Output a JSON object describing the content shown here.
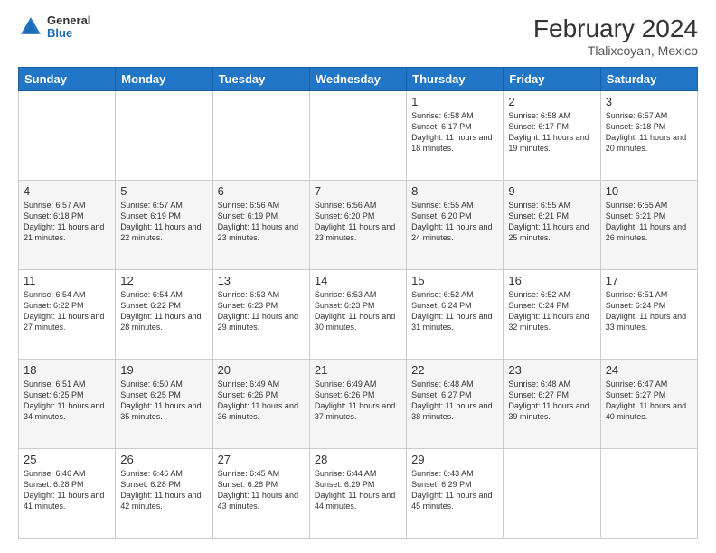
{
  "header": {
    "month_year": "February 2024",
    "location": "Tlalixcoyan, Mexico",
    "logo_general": "General",
    "logo_blue": "Blue"
  },
  "days_of_week": [
    "Sunday",
    "Monday",
    "Tuesday",
    "Wednesday",
    "Thursday",
    "Friday",
    "Saturday"
  ],
  "weeks": [
    [
      {
        "day": "",
        "info": ""
      },
      {
        "day": "",
        "info": ""
      },
      {
        "day": "",
        "info": ""
      },
      {
        "day": "",
        "info": ""
      },
      {
        "day": "1",
        "info": "Sunrise: 6:58 AM\nSunset: 6:17 PM\nDaylight: 11 hours and 18 minutes."
      },
      {
        "day": "2",
        "info": "Sunrise: 6:58 AM\nSunset: 6:17 PM\nDaylight: 11 hours and 19 minutes."
      },
      {
        "day": "3",
        "info": "Sunrise: 6:57 AM\nSunset: 6:18 PM\nDaylight: 11 hours and 20 minutes."
      }
    ],
    [
      {
        "day": "4",
        "info": "Sunrise: 6:57 AM\nSunset: 6:18 PM\nDaylight: 11 hours and 21 minutes."
      },
      {
        "day": "5",
        "info": "Sunrise: 6:57 AM\nSunset: 6:19 PM\nDaylight: 11 hours and 22 minutes."
      },
      {
        "day": "6",
        "info": "Sunrise: 6:56 AM\nSunset: 6:19 PM\nDaylight: 11 hours and 23 minutes."
      },
      {
        "day": "7",
        "info": "Sunrise: 6:56 AM\nSunset: 6:20 PM\nDaylight: 11 hours and 23 minutes."
      },
      {
        "day": "8",
        "info": "Sunrise: 6:55 AM\nSunset: 6:20 PM\nDaylight: 11 hours and 24 minutes."
      },
      {
        "day": "9",
        "info": "Sunrise: 6:55 AM\nSunset: 6:21 PM\nDaylight: 11 hours and 25 minutes."
      },
      {
        "day": "10",
        "info": "Sunrise: 6:55 AM\nSunset: 6:21 PM\nDaylight: 11 hours and 26 minutes."
      }
    ],
    [
      {
        "day": "11",
        "info": "Sunrise: 6:54 AM\nSunset: 6:22 PM\nDaylight: 11 hours and 27 minutes."
      },
      {
        "day": "12",
        "info": "Sunrise: 6:54 AM\nSunset: 6:22 PM\nDaylight: 11 hours and 28 minutes."
      },
      {
        "day": "13",
        "info": "Sunrise: 6:53 AM\nSunset: 6:23 PM\nDaylight: 11 hours and 29 minutes."
      },
      {
        "day": "14",
        "info": "Sunrise: 6:53 AM\nSunset: 6:23 PM\nDaylight: 11 hours and 30 minutes."
      },
      {
        "day": "15",
        "info": "Sunrise: 6:52 AM\nSunset: 6:24 PM\nDaylight: 11 hours and 31 minutes."
      },
      {
        "day": "16",
        "info": "Sunrise: 6:52 AM\nSunset: 6:24 PM\nDaylight: 11 hours and 32 minutes."
      },
      {
        "day": "17",
        "info": "Sunrise: 6:51 AM\nSunset: 6:24 PM\nDaylight: 11 hours and 33 minutes."
      }
    ],
    [
      {
        "day": "18",
        "info": "Sunrise: 6:51 AM\nSunset: 6:25 PM\nDaylight: 11 hours and 34 minutes."
      },
      {
        "day": "19",
        "info": "Sunrise: 6:50 AM\nSunset: 6:25 PM\nDaylight: 11 hours and 35 minutes."
      },
      {
        "day": "20",
        "info": "Sunrise: 6:49 AM\nSunset: 6:26 PM\nDaylight: 11 hours and 36 minutes."
      },
      {
        "day": "21",
        "info": "Sunrise: 6:49 AM\nSunset: 6:26 PM\nDaylight: 11 hours and 37 minutes."
      },
      {
        "day": "22",
        "info": "Sunrise: 6:48 AM\nSunset: 6:27 PM\nDaylight: 11 hours and 38 minutes."
      },
      {
        "day": "23",
        "info": "Sunrise: 6:48 AM\nSunset: 6:27 PM\nDaylight: 11 hours and 39 minutes."
      },
      {
        "day": "24",
        "info": "Sunrise: 6:47 AM\nSunset: 6:27 PM\nDaylight: 11 hours and 40 minutes."
      }
    ],
    [
      {
        "day": "25",
        "info": "Sunrise: 6:46 AM\nSunset: 6:28 PM\nDaylight: 11 hours and 41 minutes."
      },
      {
        "day": "26",
        "info": "Sunrise: 6:46 AM\nSunset: 6:28 PM\nDaylight: 11 hours and 42 minutes."
      },
      {
        "day": "27",
        "info": "Sunrise: 6:45 AM\nSunset: 6:28 PM\nDaylight: 11 hours and 43 minutes."
      },
      {
        "day": "28",
        "info": "Sunrise: 6:44 AM\nSunset: 6:29 PM\nDaylight: 11 hours and 44 minutes."
      },
      {
        "day": "29",
        "info": "Sunrise: 6:43 AM\nSunset: 6:29 PM\nDaylight: 11 hours and 45 minutes."
      },
      {
        "day": "",
        "info": ""
      },
      {
        "day": "",
        "info": ""
      }
    ]
  ]
}
